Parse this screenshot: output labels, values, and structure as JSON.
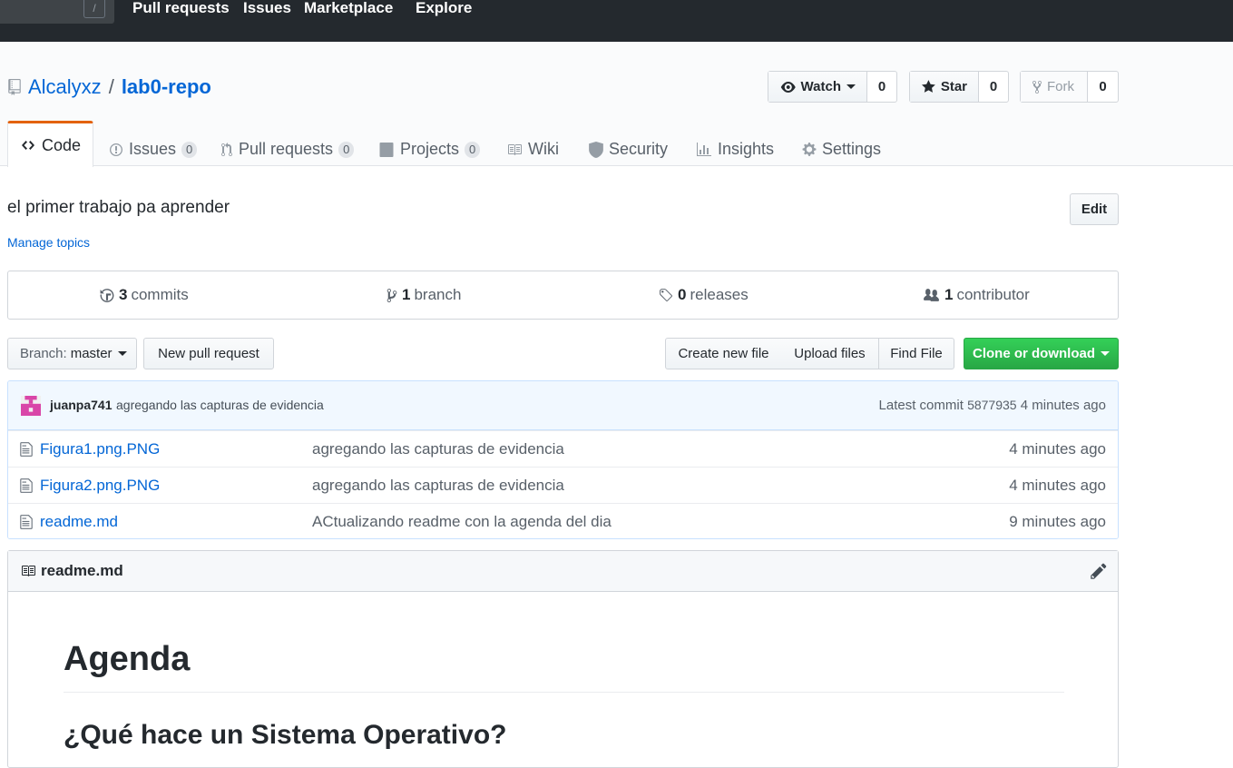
{
  "topnav": {
    "search_key": "/",
    "links": [
      "Pull requests",
      "Issues",
      "Marketplace",
      "Explore"
    ]
  },
  "repo": {
    "owner": "Alcalyxz",
    "separator": "/",
    "name": "lab0-repo"
  },
  "actions": {
    "watch_label": "Watch",
    "watch_count": "0",
    "star_label": "Star",
    "star_count": "0",
    "fork_label": "Fork",
    "fork_count": "0"
  },
  "tabs": {
    "code": "Code",
    "issues": "Issues",
    "issues_count": "0",
    "pulls": "Pull requests",
    "pulls_count": "0",
    "projects": "Projects",
    "projects_count": "0",
    "wiki": "Wiki",
    "security": "Security",
    "insights": "Insights",
    "settings": "Settings"
  },
  "about": {
    "description": "el primer trabajo pa aprender",
    "manage_topics": "Manage topics",
    "edit_label": "Edit"
  },
  "summary": {
    "commits_count": "3",
    "commits_label": "commits",
    "branches_count": "1",
    "branches_label": "branch",
    "releases_count": "0",
    "releases_label": "releases",
    "contributors_count": "1",
    "contributors_label": "contributor"
  },
  "filenav": {
    "branch_prefix": "Branch:",
    "branch_name": "master",
    "new_pr": "New pull request",
    "create_file": "Create new file",
    "upload_files": "Upload files",
    "find_file": "Find File",
    "clone": "Clone or download"
  },
  "commit": {
    "author": "juanpa741",
    "message": "agregando las capturas de evidencia",
    "latest_label": "Latest commit",
    "sha": "5877935",
    "age": "4 minutes ago"
  },
  "files": [
    {
      "name": "Figura1.png.PNG",
      "message": "agregando las capturas de evidencia",
      "age": "4 minutes ago"
    },
    {
      "name": "Figura2.png.PNG",
      "message": "agregando las capturas de evidencia",
      "age": "4 minutes ago"
    },
    {
      "name": "readme.md",
      "message": "ACtualizando readme con la agenda del dia",
      "age": "9 minutes ago"
    }
  ],
  "readme": {
    "filename": "readme.md",
    "h1": "Agenda",
    "h2": "¿Qué hace un Sistema Operativo?"
  },
  "colors": {
    "header_bg": "#24292e",
    "link": "#0366d6",
    "clone_green": "#28a745",
    "active_tab_accent": "#e36209",
    "avatar_magenta": "#d946a8"
  }
}
